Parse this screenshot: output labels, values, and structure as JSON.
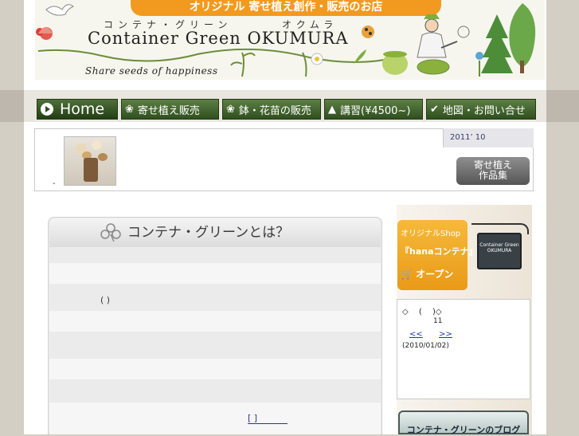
{
  "header": {
    "top_banner": "オリジナル 寄せ植え創作・販売のお店",
    "kana_left": "コンテナ・グリーン",
    "kana_right": "オクムラ",
    "brand": "Container Green OKUMURA",
    "tagline": "Share seeds of happiness"
  },
  "nav": {
    "items": [
      {
        "label": "Home",
        "icon": "play-icon"
      },
      {
        "label": "寄せ植え販売",
        "icon": "leaf-icon"
      },
      {
        "label": "鉢・花苗の販売",
        "icon": "leaf-icon"
      },
      {
        "label": "講習(¥4500~)",
        "icon": "tree-icon"
      },
      {
        "label": "地図・お問い合せ",
        "icon": "check-icon"
      }
    ]
  },
  "banner": {
    "date": "2011’ 10",
    "gallery_button": "寄せ植え\n作品集",
    "dot": "-"
  },
  "main": {
    "title": "コンテナ・グリーンとは？",
    "paren": "( )",
    "link": "[ ]"
  },
  "sidebar": {
    "shop_line1": "オリジナルShop",
    "shop_line2": "『hanaコンテナ』",
    "shop_line3": "オープン",
    "sign_text": "Container Green OKUMURA",
    "calendar": {
      "title": "◇　 (　 )◇",
      "day": "11",
      "prev": "<<",
      "next": ">>",
      "date": "(2010/01/02)"
    },
    "blog_label": "コンテナ・グリーンのブログ"
  },
  "colors": {
    "orange": "#f29a1f",
    "nav_green": "#3e5f2c",
    "link_blue": "#2233aa"
  }
}
